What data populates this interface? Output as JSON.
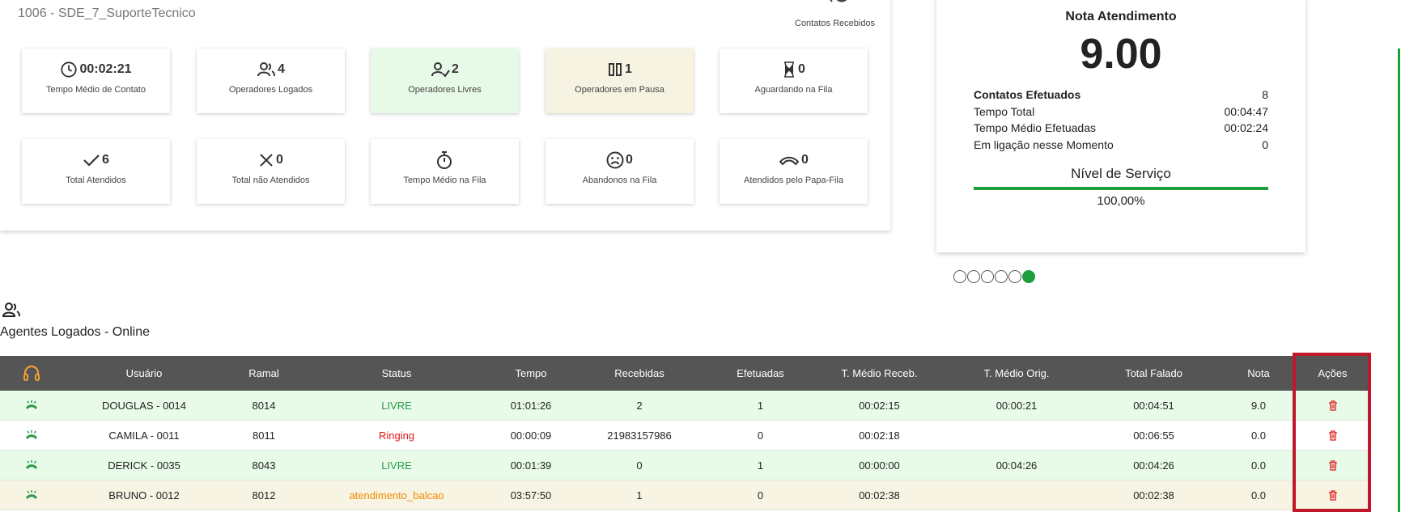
{
  "queue": {
    "title": "1006 - SDE_7_SuporteTecnico",
    "contacts_received_label": "Contatos Recebidos",
    "stats": [
      {
        "icon": "clock-icon",
        "value": "00:02:21",
        "label": "Tempo Médio de Contato"
      },
      {
        "icon": "users-icon",
        "value": "4",
        "label": "Operadores Logados"
      },
      {
        "icon": "user-check-icon",
        "value": "2",
        "label": "Operadores Livres"
      },
      {
        "icon": "pause-icon",
        "value": "1",
        "label": "Operadores em Pausa"
      },
      {
        "icon": "hourglass-icon",
        "value": "0",
        "label": "Aguardando na Fila"
      },
      {
        "icon": "check-icon",
        "value": "6",
        "label": "Total Atendidos"
      },
      {
        "icon": "x-icon",
        "value": "0",
        "label": "Total não Atendidos"
      },
      {
        "icon": "stopwatch-icon",
        "value": "",
        "label": "Tempo Médio na Fila"
      },
      {
        "icon": "sad-face-icon",
        "value": "0",
        "label": "Abandonos na Fila"
      },
      {
        "icon": "phone-hangup-icon",
        "value": "0",
        "label": "Atendidos pelo Papa-Fila"
      }
    ]
  },
  "rating": {
    "title": "Nota Atendimento",
    "score": "9.00",
    "rows": [
      {
        "label": "Contatos Efetuados",
        "value": "8"
      },
      {
        "label": "Tempo Total",
        "value": "00:04:47"
      },
      {
        "label": "Tempo Médio Efetuadas",
        "value": "00:02:24"
      },
      {
        "label": "Em ligação nesse Momento",
        "value": "0"
      }
    ],
    "service_title": "Nível de Serviço",
    "service_value": "100,00%",
    "service_fraction": 1.0,
    "service_color": "#1e9e3e"
  },
  "carousel": {
    "count": 6,
    "active_index": 5
  },
  "agents": {
    "title": "Agentes Logados - Online",
    "columns": [
      "",
      "Usuário",
      "Ramal",
      "Status",
      "Tempo",
      "Recebidas",
      "Efetuadas",
      "T. Médio Receb.",
      "T. Médio Orig.",
      "Total Falado",
      "Nota",
      "Ações"
    ],
    "rows": [
      {
        "user": "DOUGLAS - 0014",
        "ramal": "8014",
        "status": "LIVRE",
        "tempo": "01:01:26",
        "recebidas": "2",
        "efetuadas": "1",
        "tm_receb": "00:02:15",
        "tm_orig": "00:00:21",
        "total": "00:04:51",
        "nota": "9.0"
      },
      {
        "user": "CAMILA - 0011",
        "ramal": "8011",
        "status": "Ringing",
        "tempo": "00:00:09",
        "recebidas": "21983157986",
        "efetuadas": "0",
        "tm_receb": "00:02:18",
        "tm_orig": "",
        "total": "00:06:55",
        "nota": "0.0"
      },
      {
        "user": "DERICK - 0035",
        "ramal": "8043",
        "status": "LIVRE",
        "tempo": "00:01:39",
        "recebidas": "0",
        "efetuadas": "1",
        "tm_receb": "00:00:00",
        "tm_orig": "00:04:26",
        "total": "00:04:26",
        "nota": "0.0"
      },
      {
        "user": "BRUNO - 0012",
        "ramal": "8012",
        "status": "atendimento_balcao",
        "tempo": "03:57:50",
        "recebidas": "1",
        "efetuadas": "0",
        "tm_receb": "00:02:38",
        "tm_orig": "",
        "total": "00:02:38",
        "nota": "0.0"
      }
    ]
  },
  "colors": {
    "accent_green": "#1e9e3e",
    "header_bg": "#555555",
    "headset_orange": "#f0a030",
    "delete_red": "#e0161b",
    "highlight_red": "#c0182a"
  }
}
